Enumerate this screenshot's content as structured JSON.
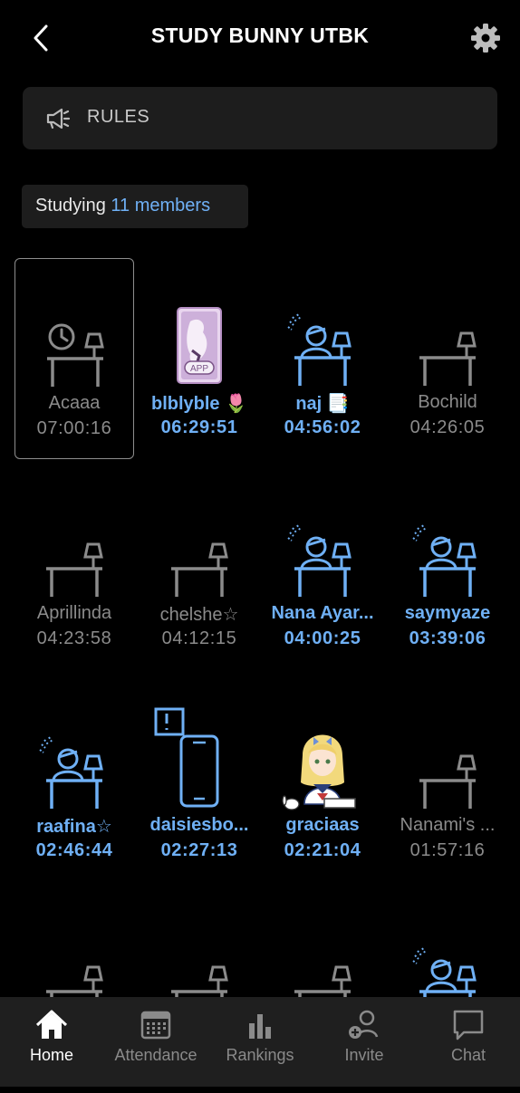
{
  "header": {
    "title": "STUDY BUNNY UTBK"
  },
  "rules": {
    "label": "RULES"
  },
  "studying": {
    "label": "Studying",
    "count": "11 members"
  },
  "colors": {
    "accent": "#6fb0f5",
    "idle": "#8b8b8b",
    "panel": "#1d1d1d",
    "nav_bg": "#1f1f1f"
  },
  "members": [
    {
      "name": "Acaaa",
      "time": "07:00:16",
      "status": "idle",
      "icon": "desk-clock-icon",
      "selected": true
    },
    {
      "name": "blblyble 🌷",
      "time": "06:29:51",
      "status": "active",
      "icon": "tarot-card-avatar"
    },
    {
      "name": "naj 📑",
      "time": "04:56:02",
      "status": "active",
      "icon": "studying-person-icon"
    },
    {
      "name": "Bochild",
      "time": "04:26:05",
      "status": "idle",
      "icon": "empty-desk-icon"
    },
    {
      "name": "Aprillinda",
      "time": "04:23:58",
      "status": "idle",
      "icon": "empty-desk-icon"
    },
    {
      "name": "chelshe☆",
      "time": "04:12:15",
      "status": "idle",
      "icon": "empty-desk-icon"
    },
    {
      "name": "Nana Ayar...",
      "time": "04:00:25",
      "status": "active",
      "icon": "studying-person-icon"
    },
    {
      "name": "saymyaze",
      "time": "03:39:06",
      "status": "active",
      "icon": "studying-person-icon"
    },
    {
      "name": "raafina☆",
      "time": "02:46:44",
      "status": "active",
      "icon": "studying-person-icon"
    },
    {
      "name": "daisiesbo...",
      "time": "02:27:13",
      "status": "active",
      "icon": "phone-alert-icon"
    },
    {
      "name": "graciaas",
      "time": "02:21:04",
      "status": "active",
      "icon": "anime-girl-avatar"
    },
    {
      "name": "Nanami's ...",
      "time": "01:57:16",
      "status": "idle",
      "icon": "empty-desk-icon"
    },
    {
      "name": "",
      "time": "",
      "status": "idle",
      "icon": "empty-desk-icon"
    },
    {
      "name": "",
      "time": "",
      "status": "idle",
      "icon": "empty-desk-icon"
    },
    {
      "name": "",
      "time": "",
      "status": "idle",
      "icon": "empty-desk-icon"
    },
    {
      "name": "",
      "time": "",
      "status": "active",
      "icon": "studying-person-icon"
    }
  ],
  "nav": [
    {
      "label": "Home",
      "icon": "home-icon",
      "current": true
    },
    {
      "label": "Attendance",
      "icon": "calendar-icon"
    },
    {
      "label": "Rankings",
      "icon": "bar-chart-icon"
    },
    {
      "label": "Invite",
      "icon": "add-person-icon"
    },
    {
      "label": "Chat",
      "icon": "chat-bubble-icon"
    }
  ]
}
